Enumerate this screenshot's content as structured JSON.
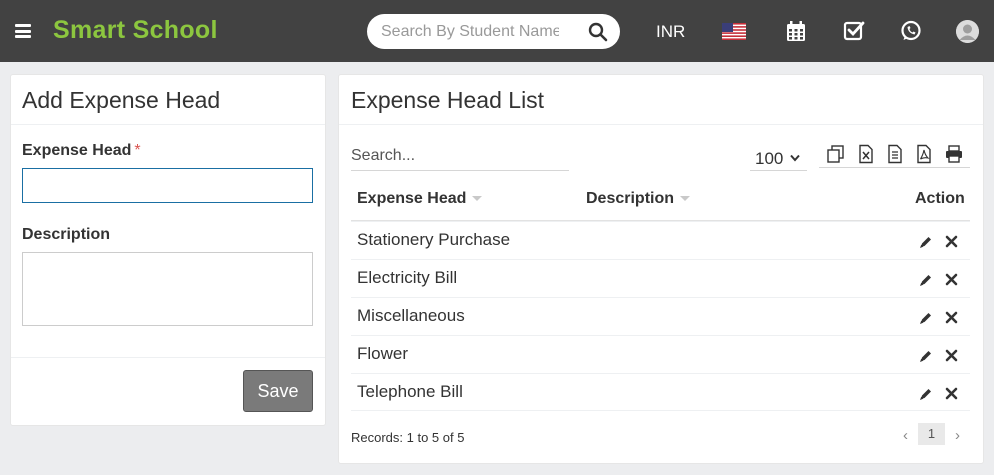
{
  "header": {
    "brand": "Smart School",
    "search_placeholder": "Search By Student Name",
    "currency": "INR",
    "icons": [
      "menu-icon",
      "search-icon",
      "us-flag-icon",
      "calendar-icon",
      "checkbox-icon",
      "whatsapp-icon",
      "user-avatar-icon"
    ]
  },
  "form": {
    "title": "Add Expense Head",
    "expense_head_label": "Expense Head",
    "required_mark": "*",
    "expense_head_value": "",
    "description_label": "Description",
    "description_value": "",
    "save_label": "Save"
  },
  "list": {
    "title": "Expense Head List",
    "search_placeholder": "Search...",
    "page_length": "100",
    "toolbar_icons": [
      "copy-icon",
      "excel-icon",
      "csv-icon",
      "pdf-icon",
      "print-icon"
    ],
    "columns": {
      "expense_head": "Expense Head",
      "description": "Description",
      "action": "Action"
    },
    "rows": [
      {
        "expense_head": "Stationery Purchase",
        "description": ""
      },
      {
        "expense_head": "Electricity Bill",
        "description": ""
      },
      {
        "expense_head": "Miscellaneous",
        "description": ""
      },
      {
        "expense_head": "Flower",
        "description": ""
      },
      {
        "expense_head": "Telephone Bill",
        "description": ""
      }
    ],
    "records_text": "Records: 1 to 5 of 5",
    "pagination": {
      "prev": "‹",
      "current": "1",
      "next": "›"
    }
  },
  "colors": {
    "topbar": "#424242",
    "brand": "#8cc63f",
    "save_button": "#7a7a7a",
    "input_focus_border": "#1a6fa3",
    "required": "#d9534f"
  }
}
